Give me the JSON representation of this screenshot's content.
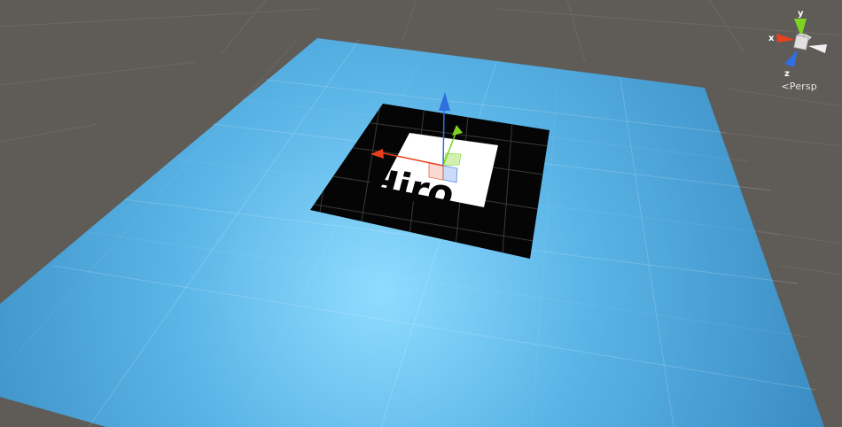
{
  "scene": {
    "marker_text": "Hiro",
    "colors": {
      "background": "#5f5b57",
      "plane_light": "#8fdcff",
      "plane_mid": "#5ab4e6",
      "plane_dark": "#3b8fc4",
      "marker_black": "#050505",
      "marker_white": "#ffffff",
      "axis_x": "#e8401c",
      "axis_y": "#7ed321",
      "axis_z": "#2f6fe0"
    }
  },
  "gizmo": {
    "x_label": "x",
    "y_label": "y",
    "z_label": "z",
    "projection_label": "Persp",
    "projection_icon": "chevron-left-icon"
  }
}
